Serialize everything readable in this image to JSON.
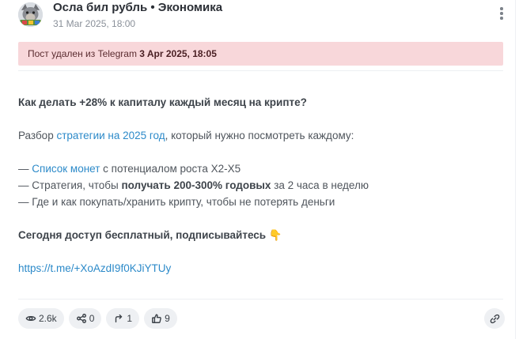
{
  "post": {
    "channel_title": "Осла бил рубль • Экономика",
    "date": "31 Mar 2025, 18:00",
    "deleted_notice_prefix": "Пост удален из Telegram ",
    "deleted_notice_date": "3 Apr 2025, 18:05",
    "body": {
      "headline": "Как делать +28% к капиталу каждый месяц на крипте?",
      "line2_prefix": "Разбор ",
      "line2_link": "стратегии на 2025 год",
      "line2_suffix": ", который нужно посмотреть каждому:",
      "item1_prefix": "— ",
      "item1_link": "Список монет",
      "item1_suffix": " с потенциалом роста Х2-Х5",
      "item2_prefix": "— Стратегия, чтобы ",
      "item2_bold": "получать 200-300% годовых",
      "item2_suffix": " за 2 часа в неделю",
      "item3": "— Где и как покупать/хранить крипту, чтобы не потерять деньги",
      "cta": "Сегодня доступ бесплатный, подписывайтесь 👇",
      "url": "https://t.me/+XoAzdI9f0KJiYTUy"
    }
  },
  "stats": {
    "views": "2.6k",
    "shares": "0",
    "forwards": "1",
    "likes": "9"
  },
  "icons": {
    "views": "eye-icon",
    "shares": "share-nodes-icon",
    "forwards": "forward-arrow-icon",
    "likes": "thumbs-up-icon",
    "link": "link-icon",
    "more": "more-vertical-icon"
  },
  "colors": {
    "banner_bg": "#f8d7da",
    "link": "#2c8ac9",
    "pill_bg": "#eef0f3"
  }
}
